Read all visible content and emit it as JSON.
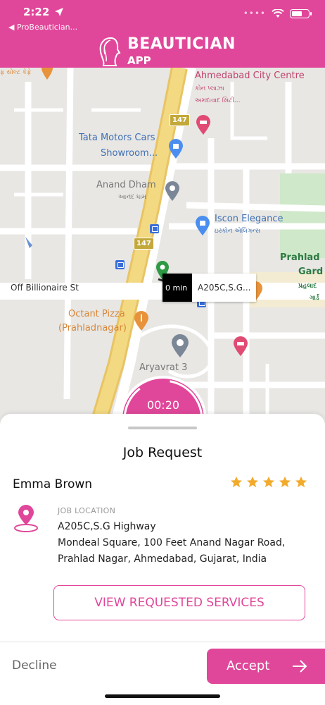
{
  "status_bar": {
    "time": "2:22",
    "back_app": "◀ ProBeautician..."
  },
  "header": {
    "title": "BEAUTICIAN",
    "subtitle": "APP",
    "brand_color": "#e0479a"
  },
  "map": {
    "labels": {
      "cafe": "ફ સોલ્ટ કેફે",
      "city_centre": "Ahmedabad City Centre",
      "city_centre_gu1": "કોન પ્લાઝા",
      "city_centre_gu2": "અમદાવાદ સિટી...",
      "tata_1": "Tata Motors Cars",
      "tata_2": "Showroom...",
      "anand_dham": "Anand Dham",
      "anand_dham_gu": "આનંદ ધામ",
      "iscon": "Iscon Elegance",
      "iscon_gu": "ઇસ્કોન એલિગન્સ",
      "prahlad_1": "Prahlad",
      "prahlad_2": "Gard",
      "prahlad_gu1": "પ્રહલાદ",
      "prahlad_gu2": "ગાર્ડ",
      "billionaire": "Off Billionaire St",
      "octant_1": "Octant Pizza",
      "octant_2": "(Prahladnagar)",
      "aryavrat": "Aryavrat 3",
      "route_147_a": "147",
      "route_147_b": "147"
    },
    "eta": {
      "time": "0 min",
      "place": "A205C,S.G..."
    },
    "timer": "00:20"
  },
  "sheet": {
    "title": "Job Request",
    "customer_name": "Emma Brown",
    "rating": 5,
    "location_caption": "JOB LOCATION",
    "address_line1": "A205C,S.G Highway",
    "address_line2": "Mondeal Square, 100 Feet Anand Nagar Road,",
    "address_line3": "Prahlad Nagar, Ahmedabad, Gujarat, India",
    "view_button": "VIEW REQUESTED SERVICES",
    "decline_label": "Decline",
    "accept_label": "Accept"
  },
  "colors": {
    "accent": "#e0479a",
    "star": "#f2ab2c",
    "highway": "#f1d67b"
  }
}
